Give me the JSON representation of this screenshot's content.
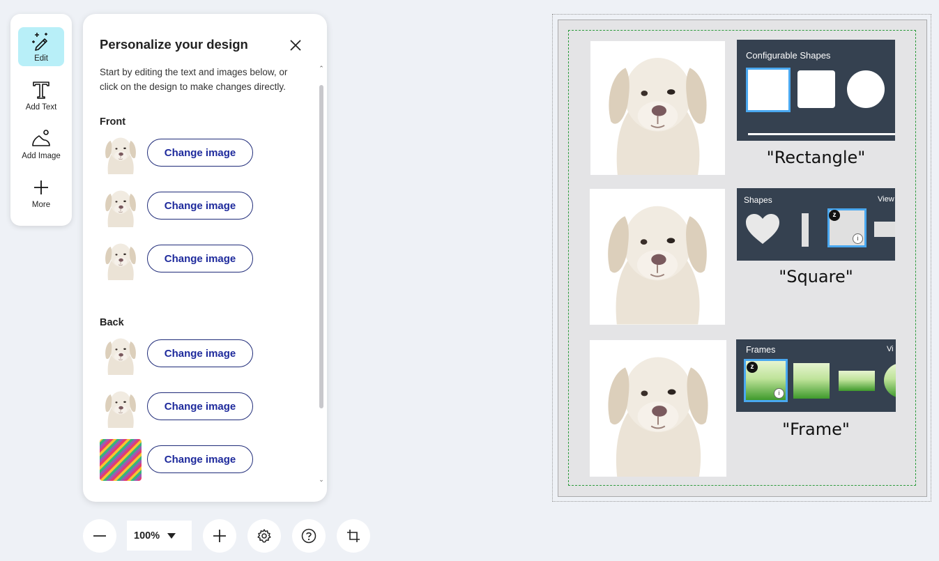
{
  "toolbar": {
    "tools": [
      {
        "label": "Edit",
        "icon": "magic-pencil-icon",
        "active": true
      },
      {
        "label": "Add Text",
        "icon": "text-t-icon",
        "active": false
      },
      {
        "label": "Add Image",
        "icon": "image-mountain-icon",
        "active": false
      },
      {
        "label": "More",
        "icon": "plus-icon",
        "active": false
      }
    ]
  },
  "panel": {
    "title": "Personalize your design",
    "description": "Start by editing the text and images below, or click on the design to make changes directly.",
    "sections": [
      {
        "heading": "Front",
        "rows": [
          {
            "button": "Change image",
            "thumb": "dog"
          },
          {
            "button": "Change image",
            "thumb": "dog"
          },
          {
            "button": "Change image",
            "thumb": "dog"
          }
        ]
      },
      {
        "heading": "Back",
        "rows": [
          {
            "button": "Change image",
            "thumb": "dog"
          },
          {
            "button": "Change image",
            "thumb": "dog"
          },
          {
            "button": "Change image",
            "thumb": "stripes"
          }
        ]
      }
    ]
  },
  "bottom_bar": {
    "zoom": "100%",
    "buttons": [
      "zoom-out-icon",
      "zoom-in-icon",
      "settings-gear-icon",
      "help-question-icon",
      "crop-icon"
    ]
  },
  "canvas": {
    "cards": [
      {
        "title": "Configurable Shapes",
        "caption": "\"Rectangle\""
      },
      {
        "title": "Shapes",
        "extra": "View",
        "caption": "\"Square\""
      },
      {
        "title": "Frames",
        "extra": "Vi",
        "caption": "\"Frame\""
      }
    ],
    "colors": {
      "safe_line": "#2a9a3a",
      "card_bg": "#354150",
      "selection": "#4aa8f0",
      "accent_btn": "#1e2a9c"
    }
  }
}
